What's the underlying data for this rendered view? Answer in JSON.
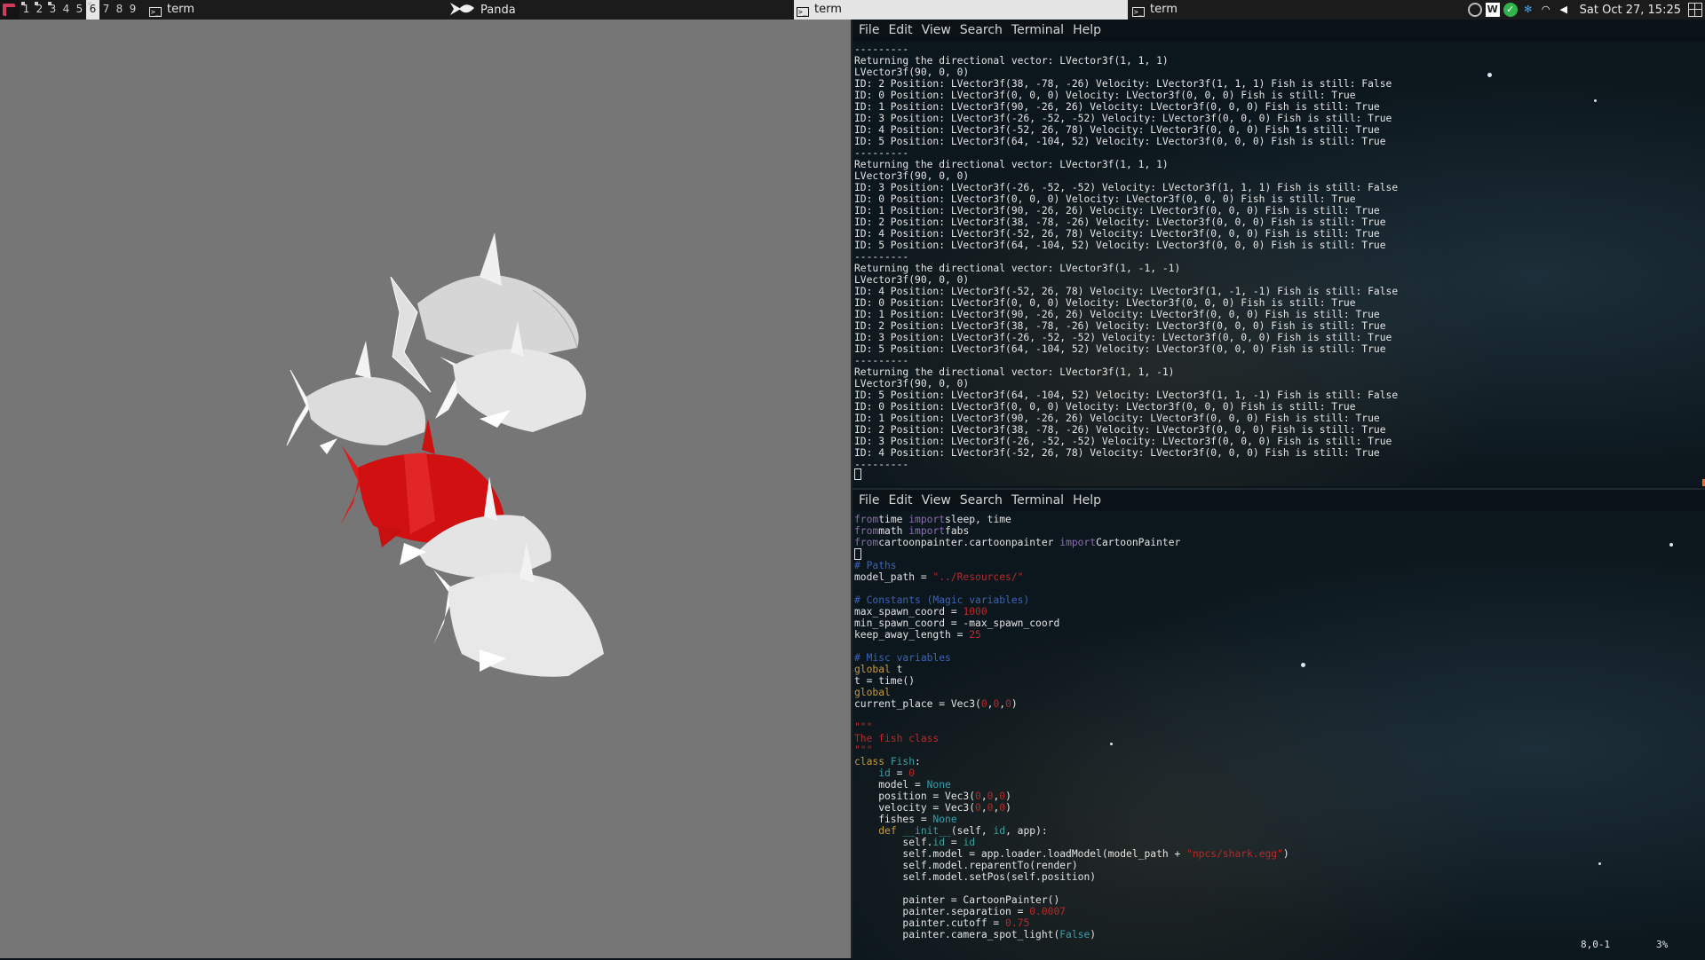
{
  "topbar": {
    "workspaces": [
      "1",
      "2",
      "3",
      "4",
      "5",
      "6",
      "7",
      "8",
      "9"
    ],
    "active_workspace": "6",
    "tasks": [
      {
        "label": "term",
        "icon": "terminal-icon"
      },
      {
        "label": "Panda",
        "icon": "fish-icon"
      },
      {
        "label": "term",
        "icon": "terminal-icon",
        "active": true
      },
      {
        "label": "term",
        "icon": "terminal-icon"
      }
    ],
    "clock": "Sat Oct 27, 15:25"
  },
  "terminal_top": {
    "menu": [
      "File",
      "Edit",
      "View",
      "Search",
      "Terminal",
      "Help"
    ],
    "lines": [
      "---------",
      "Returning the directional vector: LVector3f(1, 1, 1)",
      "LVector3f(90, 0, 0)",
      "ID: 2 Position: LVector3f(38, -78, -26) Velocity: LVector3f(1, 1, 1) Fish is still: False",
      "ID: 0 Position: LVector3f(0, 0, 0) Velocity: LVector3f(0, 0, 0) Fish is still: True",
      "ID: 1 Position: LVector3f(90, -26, 26) Velocity: LVector3f(0, 0, 0) Fish is still: True",
      "ID: 3 Position: LVector3f(-26, -52, -52) Velocity: LVector3f(0, 0, 0) Fish is still: True",
      "ID: 4 Position: LVector3f(-52, 26, 78) Velocity: LVector3f(0, 0, 0) Fish is still: True",
      "ID: 5 Position: LVector3f(64, -104, 52) Velocity: LVector3f(0, 0, 0) Fish is still: True",
      "---------",
      "Returning the directional vector: LVector3f(1, 1, 1)",
      "LVector3f(90, 0, 0)",
      "ID: 3 Position: LVector3f(-26, -52, -52) Velocity: LVector3f(1, 1, 1) Fish is still: False",
      "ID: 0 Position: LVector3f(0, 0, 0) Velocity: LVector3f(0, 0, 0) Fish is still: True",
      "ID: 1 Position: LVector3f(90, -26, 26) Velocity: LVector3f(0, 0, 0) Fish is still: True",
      "ID: 2 Position: LVector3f(38, -78, -26) Velocity: LVector3f(0, 0, 0) Fish is still: True",
      "ID: 4 Position: LVector3f(-52, 26, 78) Velocity: LVector3f(0, 0, 0) Fish is still: True",
      "ID: 5 Position: LVector3f(64, -104, 52) Velocity: LVector3f(0, 0, 0) Fish is still: True",
      "---------",
      "Returning the directional vector: LVector3f(1, -1, -1)",
      "LVector3f(90, 0, 0)",
      "ID: 4 Position: LVector3f(-52, 26, 78) Velocity: LVector3f(1, -1, -1) Fish is still: False",
      "ID: 0 Position: LVector3f(0, 0, 0) Velocity: LVector3f(0, 0, 0) Fish is still: True",
      "ID: 1 Position: LVector3f(90, -26, 26) Velocity: LVector3f(0, 0, 0) Fish is still: True",
      "ID: 2 Position: LVector3f(38, -78, -26) Velocity: LVector3f(0, 0, 0) Fish is still: True",
      "ID: 3 Position: LVector3f(-26, -52, -52) Velocity: LVector3f(0, 0, 0) Fish is still: True",
      "ID: 5 Position: LVector3f(64, -104, 52) Velocity: LVector3f(0, 0, 0) Fish is still: True",
      "---------",
      "Returning the directional vector: LVector3f(1, 1, -1)",
      "LVector3f(90, 0, 0)",
      "ID: 5 Position: LVector3f(64, -104, 52) Velocity: LVector3f(1, 1, -1) Fish is still: False",
      "ID: 0 Position: LVector3f(0, 0, 0) Velocity: LVector3f(0, 0, 0) Fish is still: True",
      "ID: 1 Position: LVector3f(90, -26, 26) Velocity: LVector3f(0, 0, 0) Fish is still: True",
      "ID: 2 Position: LVector3f(38, -78, -26) Velocity: LVector3f(0, 0, 0) Fish is still: True",
      "ID: 3 Position: LVector3f(-26, -52, -52) Velocity: LVector3f(0, 0, 0) Fish is still: True",
      "ID: 4 Position: LVector3f(-52, 26, 78) Velocity: LVector3f(0, 0, 0) Fish is still: True",
      "---------"
    ]
  },
  "terminal_bottom": {
    "menu": [
      "File",
      "Edit",
      "View",
      "Search",
      "Terminal",
      "Help"
    ],
    "code": [
      [
        [
          "imp",
          "from"
        ],
        [
          "",
          "time "
        ],
        [
          "imp",
          "import"
        ],
        [
          "",
          "sleep, time"
        ]
      ],
      [
        [
          "imp",
          "from"
        ],
        [
          "",
          "math "
        ],
        [
          "imp",
          "import"
        ],
        [
          "",
          "fabs"
        ]
      ],
      [
        [
          "imp",
          "from"
        ],
        [
          "",
          "cartoonpainter.cartoonpainter "
        ],
        [
          "imp",
          "import"
        ],
        [
          "",
          "CartoonPainter"
        ]
      ],
      [
        [
          "cursor",
          ""
        ]
      ],
      [
        [
          "cm",
          "# Paths"
        ]
      ],
      [
        [
          "",
          "model_path = "
        ],
        [
          "str",
          "\"../Resources/\""
        ]
      ],
      [
        [
          "",
          ""
        ]
      ],
      [
        [
          "cm",
          "# Constants (Magic variables)"
        ]
      ],
      [
        [
          "",
          "max_spawn_coord = "
        ],
        [
          "num",
          "1000"
        ]
      ],
      [
        [
          "",
          "min_spawn_coord = -max_spawn_coord"
        ]
      ],
      [
        [
          "",
          "keep_away_length = "
        ],
        [
          "num",
          "25"
        ]
      ],
      [
        [
          "",
          ""
        ]
      ],
      [
        [
          "cm",
          "# Misc variables"
        ]
      ],
      [
        [
          "kw",
          "global"
        ],
        [
          "",
          " t"
        ]
      ],
      [
        [
          "",
          "t = time()"
        ]
      ],
      [
        [
          "kw",
          "global"
        ],
        [
          "",
          "",
          " current_place"
        ]
      ],
      [
        [
          "",
          "current_place = Vec3("
        ],
        [
          "num",
          "0"
        ],
        [
          "",
          ","
        ],
        [
          "num",
          "0"
        ],
        [
          "",
          ","
        ],
        [
          "num",
          "0"
        ],
        [
          "",
          ")"
        ]
      ],
      [
        [
          "",
          ""
        ]
      ],
      [
        [
          "str",
          "\"\"\""
        ]
      ],
      [
        [
          "str",
          "The fish class"
        ]
      ],
      [
        [
          "str",
          "\"\"\""
        ]
      ],
      [
        [
          "kw",
          "class"
        ],
        [
          "cls",
          " Fish"
        ],
        [
          "",
          ":"
        ]
      ],
      [
        [
          "",
          "    "
        ],
        [
          "cls",
          "id"
        ],
        [
          "",
          " = "
        ],
        [
          "num",
          "0"
        ]
      ],
      [
        [
          "",
          "    model = "
        ],
        [
          "none",
          "None"
        ]
      ],
      [
        [
          "",
          "    position = Vec3("
        ],
        [
          "num",
          "0"
        ],
        [
          "",
          ","
        ],
        [
          "num",
          "0"
        ],
        [
          "",
          ","
        ],
        [
          "num",
          "0"
        ],
        [
          "",
          ")"
        ]
      ],
      [
        [
          "",
          "    velocity = Vec3("
        ],
        [
          "num",
          "0"
        ],
        [
          "",
          ","
        ],
        [
          "num",
          "0"
        ],
        [
          "",
          ","
        ],
        [
          "num",
          "0"
        ],
        [
          "",
          ")"
        ]
      ],
      [
        [
          "",
          "    fishes = "
        ],
        [
          "none",
          "None"
        ]
      ],
      [
        [
          "",
          "    "
        ],
        [
          "kw",
          "def"
        ],
        [
          "cls",
          " __init__"
        ],
        [
          "",
          "(self, "
        ],
        [
          "cls",
          "id"
        ],
        [
          "",
          ", app):"
        ]
      ],
      [
        [
          "",
          "        self."
        ],
        [
          "cls",
          "id"
        ],
        [
          "",
          " = "
        ],
        [
          "cls",
          "id"
        ]
      ],
      [
        [
          "",
          "        self.model = app.loader.loadModel(model_path + "
        ],
        [
          "str",
          "\"npcs/shark.egg\""
        ],
        [
          "",
          ")"
        ]
      ],
      [
        [
          "",
          "        self.model.reparentTo(render)"
        ]
      ],
      [
        [
          "",
          "        self.model.setPos(self.position)"
        ]
      ],
      [
        [
          "",
          ""
        ]
      ],
      [
        [
          "",
          "        painter = CartoonPainter()"
        ]
      ],
      [
        [
          "",
          "        painter.separation = "
        ],
        [
          "num",
          "0.0007"
        ]
      ],
      [
        [
          "",
          "        painter.cutoff = "
        ],
        [
          "num",
          "0.75"
        ]
      ],
      [
        [
          "",
          "        painter.camera_spot_light("
        ],
        [
          "none",
          "False"
        ],
        [
          "",
          ")"
        ]
      ]
    ],
    "status_position": "8,0-1",
    "status_percent": "3%"
  },
  "colors": {
    "panda_bg": "#767676",
    "fish_white": "#f2f2f2",
    "fish_red": "#e11a1a"
  }
}
